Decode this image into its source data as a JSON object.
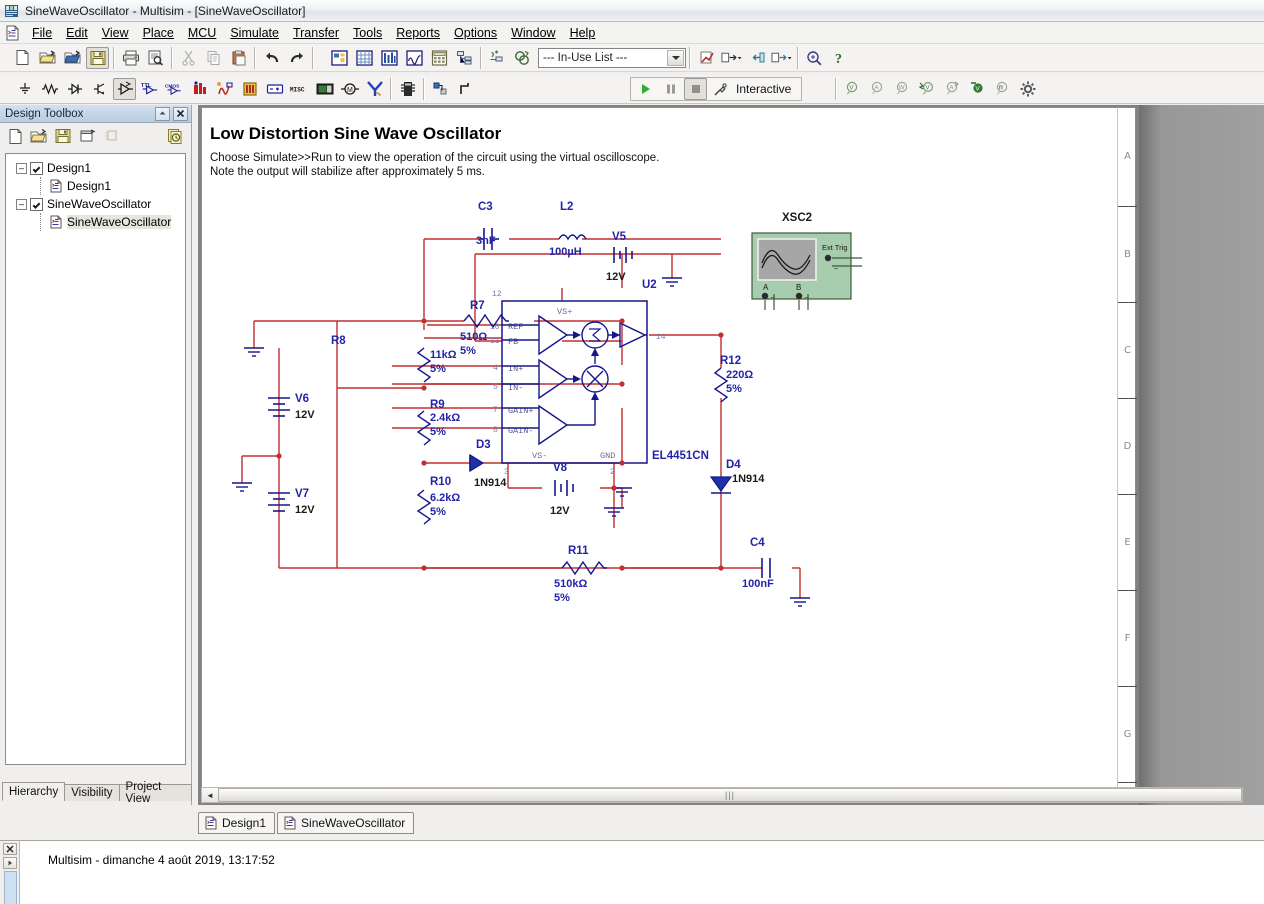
{
  "window": {
    "title": "SineWaveOscillator - Multisim - [SineWaveOscillator]",
    "app_icon": "multisim-icon"
  },
  "menu": {
    "doc_icon": "new-sheet-icon",
    "items": [
      {
        "label": "File",
        "accel": "F"
      },
      {
        "label": "Edit",
        "accel": "E"
      },
      {
        "label": "View",
        "accel": "V"
      },
      {
        "label": "Place",
        "accel": "P"
      },
      {
        "label": "MCU",
        "accel": "M"
      },
      {
        "label": "Simulate",
        "accel": "S"
      },
      {
        "label": "Transfer",
        "accel": "r"
      },
      {
        "label": "Tools",
        "accel": "T"
      },
      {
        "label": "Reports",
        "accel": "R"
      },
      {
        "label": "Options",
        "accel": "O"
      },
      {
        "label": "Window",
        "accel": "W"
      },
      {
        "label": "Help",
        "accel": "H"
      }
    ]
  },
  "toolbar_standard": {
    "buttons": [
      {
        "name": "new-icon",
        "tip": "New"
      },
      {
        "name": "open-icon",
        "tip": "Open"
      },
      {
        "name": "open-design-icon",
        "tip": "Open samples"
      },
      {
        "name": "save-icon",
        "tip": "Save"
      },
      {
        "name": "print-icon",
        "tip": "Print"
      },
      {
        "name": "print-preview-icon",
        "tip": "Print preview"
      },
      {
        "name": "cut-icon",
        "tip": "Cut"
      },
      {
        "name": "copy-icon",
        "tip": "Copy"
      },
      {
        "name": "paste-icon",
        "tip": "Paste"
      },
      {
        "name": "undo-icon",
        "tip": "Undo"
      },
      {
        "name": "redo-icon",
        "tip": "Redo"
      },
      {
        "name": "toggle-design-toolbox-icon",
        "tip": "Toggle design toolbox"
      },
      {
        "name": "toggle-spreadsheet-view-icon",
        "tip": "Toggle spreadsheet view"
      },
      {
        "name": "database-manager-icon",
        "tip": "Database manager"
      },
      {
        "name": "grapher-icon",
        "tip": "Grapher"
      },
      {
        "name": "postprocessor-icon",
        "tip": "Postprocessor"
      },
      {
        "name": "parts-list-icon",
        "tip": "Parts list"
      },
      {
        "name": "create-component-icon",
        "tip": "Create component"
      },
      {
        "name": "ercheck-icon",
        "tip": "Electrical rules check"
      },
      {
        "name": "capture-screen-area-icon",
        "tip": "Capture screen area"
      },
      {
        "name": "back-annotate-icon",
        "tip": "Back annotate"
      },
      {
        "name": "forward-annotate-icon",
        "tip": "Forward annotate"
      },
      {
        "name": "in-use-list-icon",
        "tip": "In-use list"
      },
      {
        "name": "zoom-icon",
        "tip": "Zoom"
      },
      {
        "name": "help-icon",
        "tip": "Help"
      }
    ],
    "in_use_list": {
      "value": "--- In-Use List ---",
      "placeholder": "--- In-Use List ---"
    }
  },
  "toolbar_components": {
    "buttons": [
      {
        "name": "source-icon",
        "tip": "Source"
      },
      {
        "name": "basic-icon",
        "tip": "Basic"
      },
      {
        "name": "diode-icon",
        "tip": "Diode"
      },
      {
        "name": "transistor-icon",
        "tip": "Transistor"
      },
      {
        "name": "analog-icon",
        "tip": "Analog"
      },
      {
        "name": "ttl-icon",
        "tip": "TTL"
      },
      {
        "name": "cmos-icon",
        "tip": "CMOS"
      },
      {
        "name": "misc-digital-icon",
        "tip": "Misc digital"
      },
      {
        "name": "mixed-icon",
        "tip": "Mixed"
      },
      {
        "name": "indicator-icon",
        "tip": "Indicator"
      },
      {
        "name": "power-icon",
        "tip": "Power component"
      },
      {
        "name": "misc-icon",
        "tip": "Misc"
      },
      {
        "name": "advanced-peripherals-icon",
        "tip": "Advanced peripherals"
      },
      {
        "name": "rf-icon",
        "tip": "RF"
      },
      {
        "name": "electro-mechanical-icon",
        "tip": "Electro mechanical"
      },
      {
        "name": "ni-components-icon",
        "tip": "NI components"
      },
      {
        "name": "connectors-icon",
        "tip": "Connectors"
      },
      {
        "name": "hierarchical-block-icon",
        "tip": "Hierarchical block"
      },
      {
        "name": "bus-icon",
        "tip": "Place bus"
      }
    ]
  },
  "simulation": {
    "run_icon": "run-play-icon",
    "pause_icon": "pause-icon",
    "stop_icon": "stop-icon",
    "mode_icon": "interactive-probe-icon",
    "mode_label": "Interactive",
    "instruments": [
      {
        "name": "voltmeter-probe-icon",
        "tip": "Voltage probe"
      },
      {
        "name": "ammeter-probe-icon",
        "tip": "Current probe"
      },
      {
        "name": "wattmeter-probe-icon",
        "tip": "Power probe"
      },
      {
        "name": "differential-voltage-probe-icon",
        "tip": "Differential voltage probe"
      },
      {
        "name": "current-arrow-probe-icon",
        "tip": "Current arrow probe"
      },
      {
        "name": "referenced-voltage-probe-icon",
        "tip": "Referenced voltage probe"
      },
      {
        "name": "digital-probe-icon",
        "tip": "Digital probe"
      },
      {
        "name": "probe-settings-icon",
        "tip": "Probe settings"
      }
    ]
  },
  "design_toolbox": {
    "title": "Design Toolbox",
    "minimize_icon": "minimize-icon",
    "close_icon": "close-icon",
    "toolbar": [
      {
        "name": "new-sheet-icon"
      },
      {
        "name": "open-sheet-icon"
      },
      {
        "name": "save-sheet-icon"
      },
      {
        "name": "new-subsheet-icon"
      },
      {
        "name": "rename-sheet-icon"
      },
      {
        "name": "history-icon"
      }
    ],
    "tree": [
      {
        "label": "Design1",
        "level": 0,
        "type": "project",
        "expanded": true,
        "checked": true,
        "selected": false
      },
      {
        "label": "Design1",
        "level": 1,
        "type": "sheet",
        "selected": false
      },
      {
        "label": "SineWaveOscillator",
        "level": 0,
        "type": "project",
        "expanded": true,
        "checked": true,
        "selected": false
      },
      {
        "label": "SineWaveOscillator",
        "level": 1,
        "type": "sheet",
        "selected": true
      }
    ],
    "tabs": [
      {
        "label": "Hierarchy",
        "active": true
      },
      {
        "label": "Visibility",
        "active": false
      },
      {
        "label": "Project View",
        "active": false
      }
    ]
  },
  "document_tabs": [
    {
      "label": "Design1",
      "icon": "sheet-icon",
      "active": false
    },
    {
      "label": "SineWaveOscillator",
      "icon": "sheet-icon",
      "active": true
    }
  ],
  "sheet": {
    "title": "Low Distortion Sine Wave Oscillator",
    "note_line1": "Choose Simulate>>Run to view the operation of the circuit using the virtual oscilloscope.",
    "note_line2": "Note the output will stabilize after approximately 5 ms.",
    "ruler_labels": [
      "A",
      "B",
      "C",
      "D",
      "E",
      "F",
      "G"
    ],
    "colors": {
      "wire": "#c03030",
      "component": "#16168c",
      "label": "#2424a8",
      "scope_body": "#a8ccae",
      "scope_screen": "#a6a6a6"
    }
  },
  "schematic": {
    "components": [
      {
        "ref": "C3",
        "value": "3nF",
        "type": "capacitor"
      },
      {
        "ref": "L2",
        "value": "100µH",
        "type": "inductor"
      },
      {
        "ref": "V5",
        "value": "12V",
        "type": "battery"
      },
      {
        "ref": "U2",
        "value": "",
        "type": "ground"
      },
      {
        "ref": "R7",
        "value": "510Ω",
        "tol": "5%",
        "type": "resistor"
      },
      {
        "ref": "R8",
        "value": "11kΩ",
        "tol": "5%",
        "type": "resistor"
      },
      {
        "ref": "R9",
        "value": "2.4kΩ",
        "tol": "5%",
        "type": "resistor"
      },
      {
        "ref": "R10",
        "value": "6.2kΩ",
        "tol": "5%",
        "type": "resistor"
      },
      {
        "ref": "R11",
        "value": "510kΩ",
        "tol": "5%",
        "type": "resistor"
      },
      {
        "ref": "R12",
        "value": "220Ω",
        "tol": "5%",
        "type": "resistor"
      },
      {
        "ref": "V6",
        "value": "12V",
        "type": "battery"
      },
      {
        "ref": "V7",
        "value": "12V",
        "type": "battery"
      },
      {
        "ref": "V8",
        "value": "12V",
        "type": "battery"
      },
      {
        "ref": "D3",
        "value": "1N914",
        "type": "diode"
      },
      {
        "ref": "D4",
        "value": "1N914",
        "type": "diode"
      },
      {
        "ref": "C4",
        "value": "100nF",
        "type": "capacitor"
      },
      {
        "ref": "XSC2",
        "value": "",
        "type": "oscilloscope"
      }
    ],
    "ic": {
      "ref": "U2",
      "part": "EL4451CN",
      "top_label": "VS+",
      "bottom_left_label": "VS-",
      "bottom_right_label": "GND",
      "pins": [
        {
          "num": "10",
          "label": "REF"
        },
        {
          "num": "11",
          "label": "FB"
        },
        {
          "num": "4",
          "label": "IN+"
        },
        {
          "num": "5",
          "label": "IN-"
        },
        {
          "num": "7",
          "label": "GAIN+"
        },
        {
          "num": "8",
          "label": "GAIN-"
        },
        {
          "num": "12",
          "label": ""
        },
        {
          "num": "14",
          "label": ""
        },
        {
          "num": "3",
          "label": ""
        },
        {
          "num": "2",
          "label": ""
        }
      ]
    },
    "scope": {
      "ref": "XSC2",
      "ext_trig_label": "Ext Trig",
      "channel_a_label": "A",
      "channel_b_label": "B"
    }
  },
  "log": {
    "message": "Multisim  -  dimanche 4 août 2019, 13:17:52",
    "close_icon": "close-icon",
    "expand_icon": "expand-icon"
  },
  "scrollbar": {
    "left_arrow": "◄",
    "grip": "|||"
  }
}
